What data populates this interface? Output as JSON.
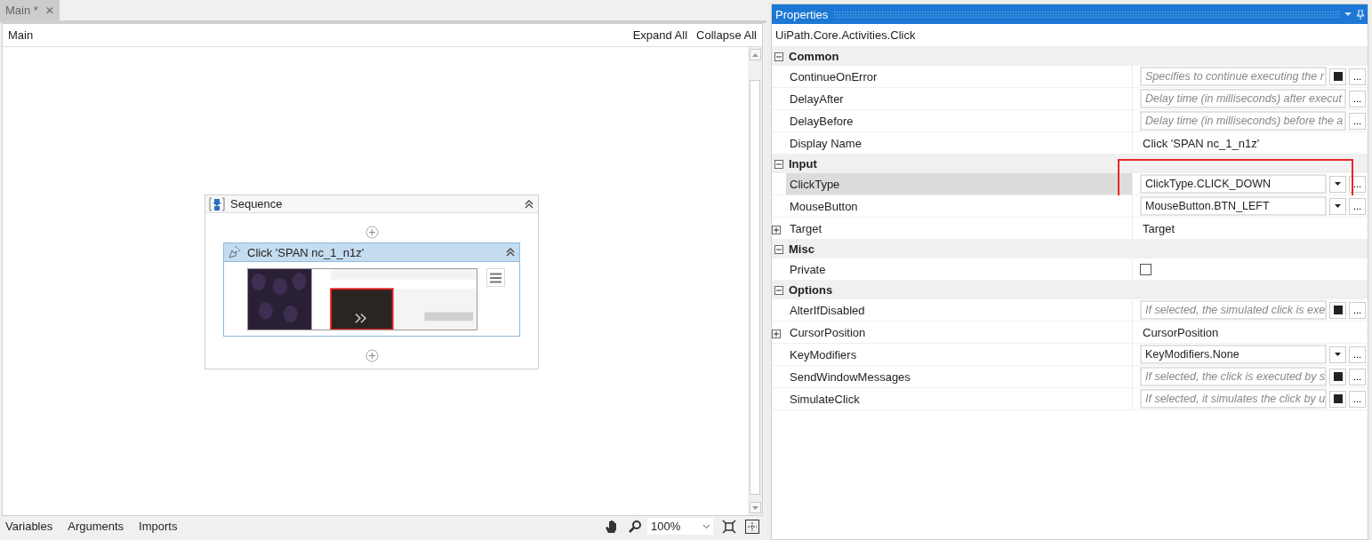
{
  "document_tab": {
    "label": "Main *",
    "close": "✕"
  },
  "designer": {
    "breadcrumb": "Main",
    "expand_all": "Expand All",
    "collapse_all": "Collapse All",
    "sequence": {
      "title": "Sequence",
      "activity": {
        "title": "Click 'SPAN  nc_1_n1z'"
      }
    },
    "bottom_tabs": [
      "Variables",
      "Arguments",
      "Imports"
    ],
    "zoom": "100%"
  },
  "properties": {
    "title": "Properties",
    "class_name": "UiPath.Core.Activities.Click",
    "more_label": "...",
    "groups": [
      {
        "name": "Common",
        "expanded": true,
        "props": [
          {
            "name": "ContinueOnError",
            "kind": "hint",
            "placeholder": "Specifies to continue executing the r",
            "toggle_button": true
          },
          {
            "name": "DelayAfter",
            "kind": "hint",
            "placeholder": "Delay time (in milliseconds) after execut"
          },
          {
            "name": "DelayBefore",
            "kind": "hint",
            "placeholder": "Delay time (in milliseconds) before the a"
          },
          {
            "name": "Display Name",
            "kind": "text",
            "value": "Click 'SPAN  nc_1_n1z'"
          }
        ]
      },
      {
        "name": "Input",
        "expanded": true,
        "props": [
          {
            "name": "ClickType",
            "kind": "dropdown",
            "value": "ClickType.CLICK_DOWN",
            "selected": true,
            "annotated": true
          },
          {
            "name": "MouseButton",
            "kind": "dropdown",
            "value": "MouseButton.BTN_LEFT",
            "selected": false
          },
          {
            "name": "Target",
            "kind": "text",
            "value": "Target",
            "expandable": true
          }
        ]
      },
      {
        "name": "Misc",
        "expanded": true,
        "props": [
          {
            "name": "Private",
            "kind": "checkbox",
            "checked": false
          }
        ]
      },
      {
        "name": "Options",
        "expanded": true,
        "props": [
          {
            "name": "AlterIfDisabled",
            "kind": "hint",
            "placeholder": "If selected, the simulated click is exe",
            "toggle_button": true
          },
          {
            "name": "CursorPosition",
            "kind": "text",
            "value": "CursorPosition",
            "expandable": true
          },
          {
            "name": "KeyModifiers",
            "kind": "dropdown",
            "value": "KeyModifiers.None",
            "selected": false
          },
          {
            "name": "SendWindowMessages",
            "kind": "hint",
            "placeholder": "If selected, the click is executed by s",
            "toggle_button": true
          },
          {
            "name": "SimulateClick",
            "kind": "hint",
            "placeholder": "If selected, it simulates the click by u",
            "toggle_button": true
          }
        ]
      }
    ]
  }
}
